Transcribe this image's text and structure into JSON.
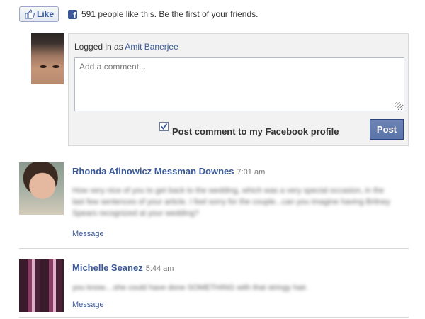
{
  "like_bar": {
    "like_label": "Like",
    "fb_logo": "f",
    "social_text": "591 people like this. Be the first of your friends."
  },
  "composer": {
    "logged_in_prefix": "Logged in as ",
    "user_name": "Amit Banerjee",
    "comment_placeholder": "Add a comment...",
    "post_to_profile_label": "Post comment to my Facebook profile",
    "post_to_profile_checked": true,
    "post_button_label": "Post"
  },
  "comments": [
    {
      "author": "Rhonda Afinowicz Messman Downes",
      "time": "7:01 am",
      "body": "How very nice of you to get back to the wedding, which was a very special occasion, in the last few sentences of your article. I feel sorry for the couple...can you imagine having Britney Spears recognized at your wedding?",
      "action": "Message"
    },
    {
      "author": "Michelle Seanez",
      "time": "5:44 am",
      "body": "you know....she could have done SOMETHING with that stringy hair.",
      "action": "Message"
    }
  ],
  "colors": {
    "link_blue": "#3b5998",
    "button_blue": "#5b74a8",
    "composer_bg": "#f2f2f2",
    "divider": "#d8d8d8"
  },
  "icons": [
    "thumbs-up-icon",
    "facebook-logo-icon",
    "checkbox-checked-icon",
    "resize-grip-icon"
  ]
}
